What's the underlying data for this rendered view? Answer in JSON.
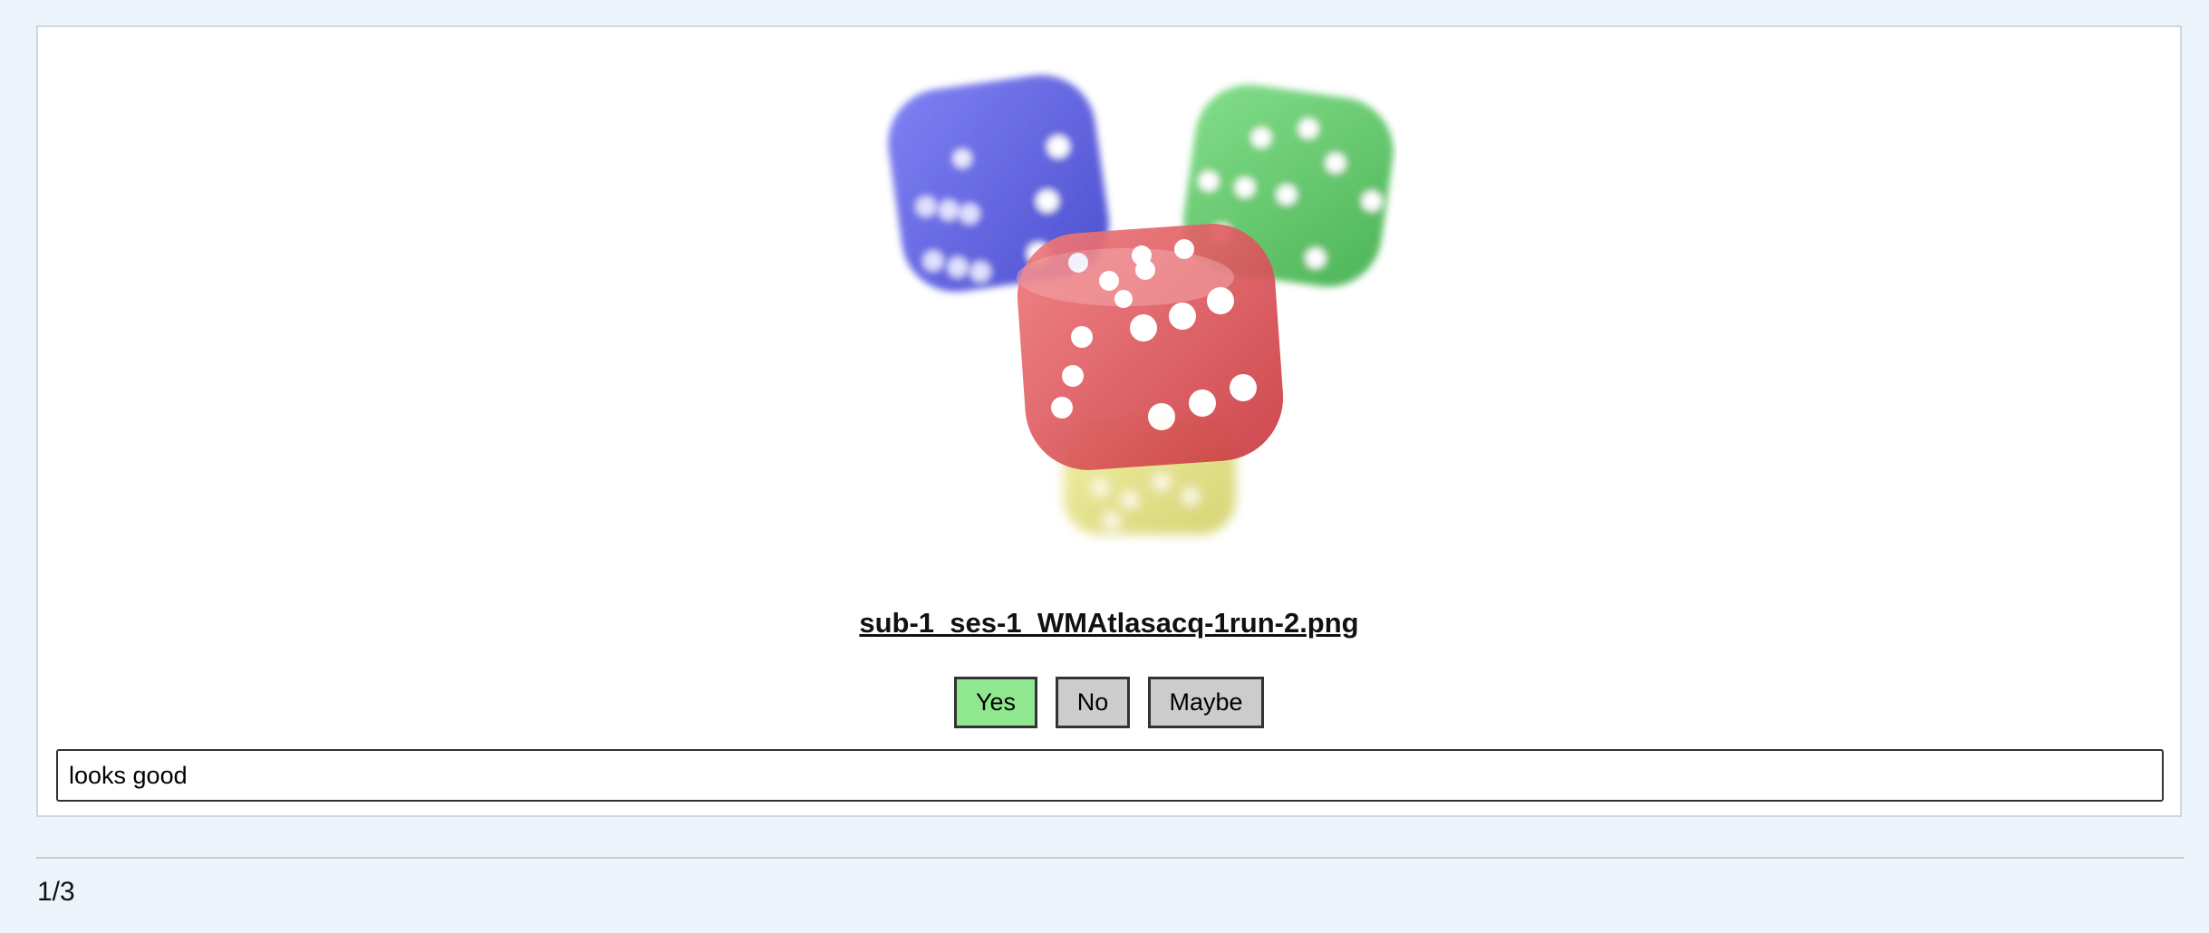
{
  "image": {
    "subject": "dice-icon",
    "colors": {
      "blue": "#3b3fe0",
      "green": "#3fbf4a",
      "red": "#e0484e",
      "yellow": "#d9d552"
    }
  },
  "filename": "sub-1_ses-1_WMAtlasacq-1run-2.png",
  "buttons": {
    "yes_label": "Yes",
    "no_label": "No",
    "maybe_label": "Maybe",
    "selected": "Yes",
    "selected_color": "#8fe88f",
    "default_color": "#cccccc"
  },
  "comment": {
    "value": "looks good"
  },
  "pagination": {
    "counter": "1/3"
  }
}
